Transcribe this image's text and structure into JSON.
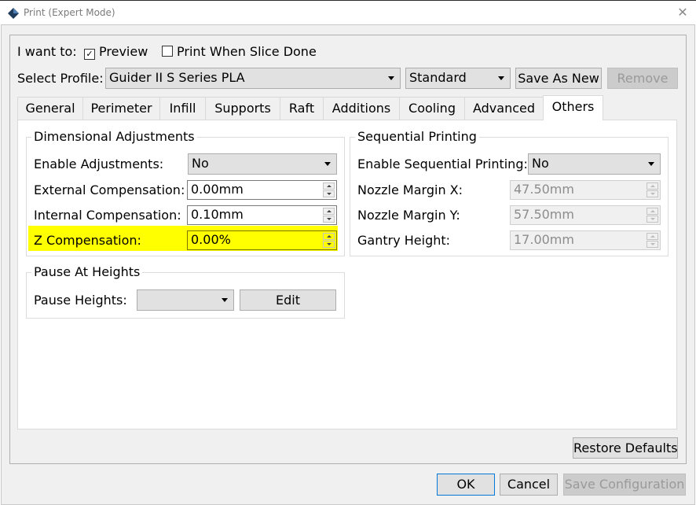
{
  "window": {
    "title": "Print (Expert Mode)",
    "close_glyph": "✕",
    "icon": "app-diamond-icon"
  },
  "top": {
    "i_want_to_label": "I want to:",
    "preview": {
      "label": "Preview",
      "checked": true
    },
    "print_when_done": {
      "label": "Print When Slice Done",
      "checked": false
    }
  },
  "profile": {
    "label": "Select Profile:",
    "selected": "Guider II S Series PLA",
    "quality": "Standard",
    "save_as_new": "Save As New",
    "remove": "Remove"
  },
  "tabs": [
    {
      "label": "General",
      "active": false
    },
    {
      "label": "Perimeter",
      "active": false
    },
    {
      "label": "Infill",
      "active": false
    },
    {
      "label": "Supports",
      "active": false
    },
    {
      "label": "Raft",
      "active": false
    },
    {
      "label": "Additions",
      "active": false
    },
    {
      "label": "Cooling",
      "active": false
    },
    {
      "label": "Advanced",
      "active": false
    },
    {
      "label": "Others",
      "active": true
    }
  ],
  "dimensional": {
    "title": "Dimensional Adjustments",
    "enable_label": "Enable Adjustments:",
    "enable_value": "No",
    "external_label": "External Compensation:",
    "external_value": "0.00mm",
    "internal_label": "Internal Compensation:",
    "internal_value": "0.10mm",
    "z_label": "Z Compensation:",
    "z_value": "0.00%",
    "highlight_color": "#ffff00"
  },
  "sequential": {
    "title": "Sequential Printing",
    "enable_label": "Enable Sequential Printing:",
    "enable_value": "No",
    "nozzle_x_label": "Nozzle Margin X:",
    "nozzle_x_value": "47.50mm",
    "nozzle_y_label": "Nozzle Margin Y:",
    "nozzle_y_value": "57.50mm",
    "gantry_label": "Gantry Height:",
    "gantry_value": "17.00mm"
  },
  "pause": {
    "title": "Pause At Heights",
    "heights_label": "Pause Heights:",
    "heights_value": "",
    "edit": "Edit"
  },
  "footer": {
    "restore_defaults": "Restore Defaults",
    "ok": "OK",
    "cancel": "Cancel",
    "save_configuration": "Save Configuration"
  }
}
